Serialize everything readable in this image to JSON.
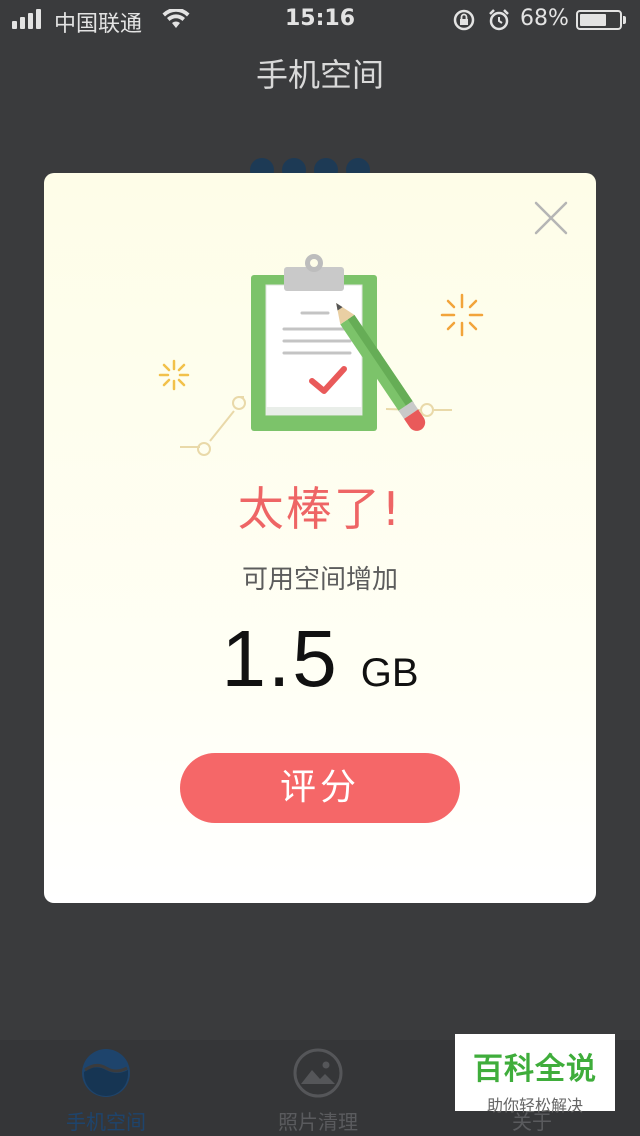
{
  "status_bar": {
    "carrier": "中国联通",
    "time": "15:16",
    "battery": "68%",
    "battery_level": 0.68
  },
  "header": {
    "title": "手机空间"
  },
  "modal": {
    "headline": "太棒了!",
    "subline": "可用空间增加",
    "amount_value": "1.5",
    "amount_unit": "GB",
    "button_label": "评分"
  },
  "tabs": [
    {
      "label": "手机空间",
      "icon": "storage-icon",
      "active": true
    },
    {
      "label": "照片清理",
      "icon": "photo-icon",
      "active": false
    },
    {
      "label": "关于",
      "icon": "about-icon",
      "active": false
    }
  ],
  "watermark": {
    "title": "百科全说",
    "subtitle": "助你轻松解决"
  },
  "colors": {
    "accent": "#f56768",
    "headline": "#ee6565",
    "active_tab": "#1e446c",
    "overlay": "#3a3b3d"
  }
}
